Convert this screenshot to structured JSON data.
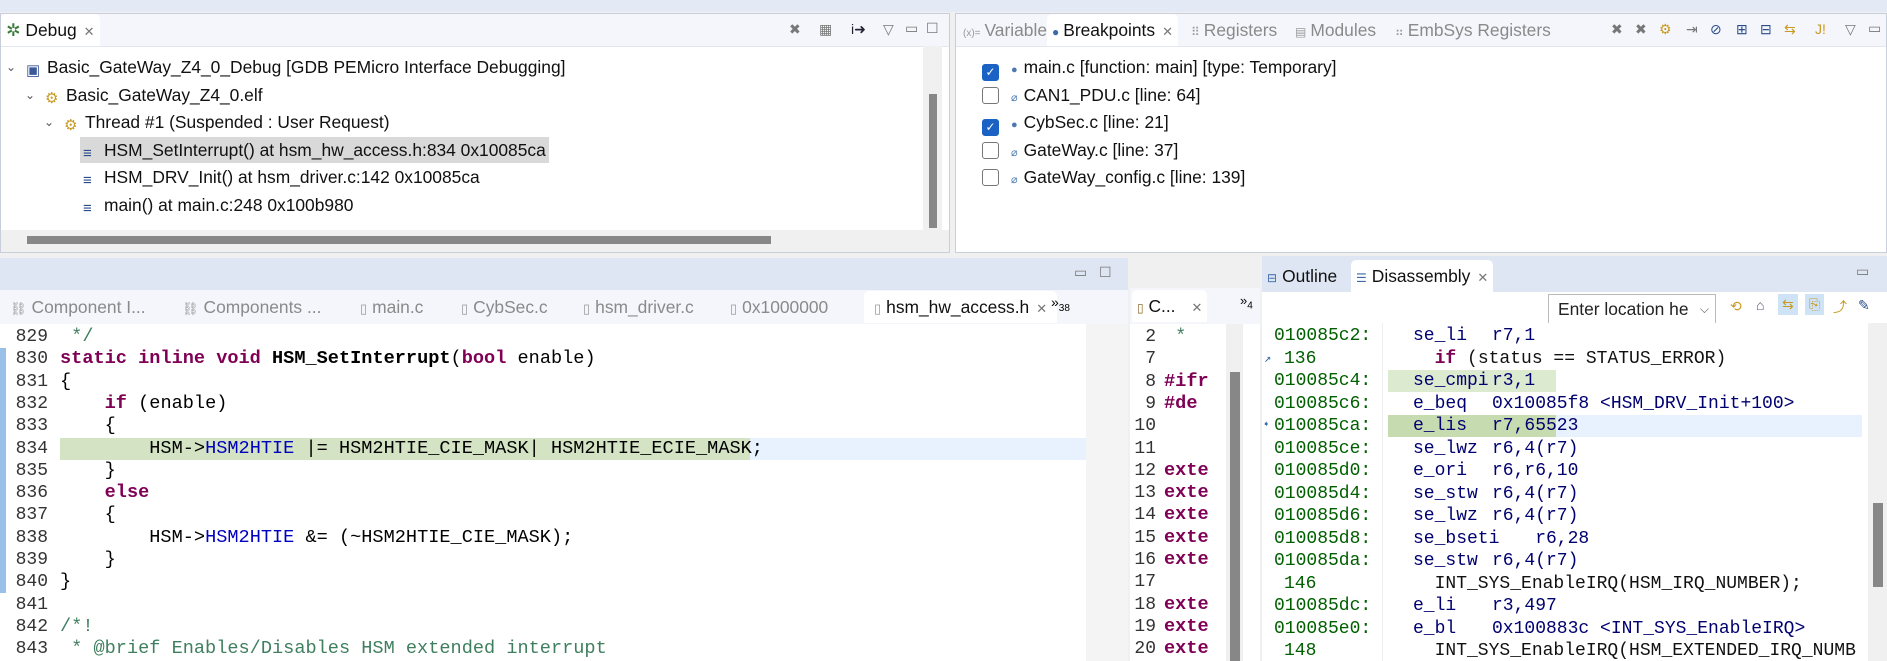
{
  "debug": {
    "tab_label": "Debug",
    "tree": [
      {
        "label": "Basic_GateWay_Z4_0_Debug [GDB PEMicro Interface Debugging]",
        "icon": "launch-config-icon",
        "level": 0
      },
      {
        "label": "Basic_GateWay_Z4_0.elf",
        "icon": "process-icon",
        "level": 1
      },
      {
        "label": "Thread #1 (Suspended : User Request)",
        "icon": "thread-icon",
        "level": 2
      },
      {
        "label": "HSM_SetInterrupt() at hsm_hw_access.h:834 0x10085ca",
        "icon": "stack-frame-icon",
        "level": 3,
        "selected": true
      },
      {
        "label": "HSM_DRV_Init() at hsm_driver.c:142 0x10085ca",
        "icon": "stack-frame-icon",
        "level": 3
      },
      {
        "label": "main() at main.c:248 0x100b980",
        "icon": "stack-frame-icon",
        "level": 3
      }
    ]
  },
  "breakpoints_view": {
    "tabs": [
      {
        "label": "Variables",
        "icon": "variables-icon"
      },
      {
        "label": "Breakpoints",
        "icon": "breakpoints-icon",
        "active": true
      },
      {
        "label": "Registers",
        "icon": "registers-icon"
      },
      {
        "label": "Modules",
        "icon": "modules-icon"
      },
      {
        "label": "EmbSys Registers",
        "icon": "embsys-registers-icon"
      }
    ],
    "items": [
      {
        "label": "main.c [function: main] [type: Temporary]",
        "checked": true
      },
      {
        "label": "CAN1_PDU.c [line: 64]",
        "checked": false
      },
      {
        "label": "CybSec.c [line: 21]",
        "checked": true
      },
      {
        "label": "GateWay.c [line: 37]",
        "checked": false
      },
      {
        "label": "GateWay_config.c [line: 139]",
        "checked": false
      }
    ]
  },
  "editor": {
    "tabs": [
      "Component I...",
      "Components ...",
      "main.c",
      "CybSec.c",
      "hsm_driver.c",
      "0x1000000",
      "hsm_hw_access.h"
    ],
    "overflow_count": "38",
    "lines": [
      {
        "n": "829",
        "seg": [
          [
            " */",
            "cm"
          ]
        ]
      },
      {
        "n": "830",
        "seg": [
          [
            "static inline void ",
            "kw"
          ],
          [
            "HSM_SetInterrupt",
            "fn"
          ],
          [
            "(",
            ""
          ],
          [
            "bool",
            "kw"
          ],
          [
            " enable)",
            ""
          ]
        ]
      },
      {
        "n": "831",
        "seg": [
          [
            "{",
            ""
          ]
        ]
      },
      {
        "n": "832",
        "seg": [
          [
            "    ",
            ""
          ],
          [
            "if",
            "kw"
          ],
          [
            " (enable)",
            ""
          ]
        ]
      },
      {
        "n": "833",
        "seg": [
          [
            "    {",
            ""
          ]
        ]
      },
      {
        "n": "834",
        "seg": [
          [
            "        HSM->",
            ""
          ],
          [
            "HSM2HTIE",
            "fld"
          ],
          [
            " |= HSM2HTIE_CIE_MASK| HSM2HTIE_ECIE_MASK;",
            ""
          ]
        ],
        "current": true
      },
      {
        "n": "835",
        "seg": [
          [
            "    }",
            ""
          ]
        ]
      },
      {
        "n": "836",
        "seg": [
          [
            "    ",
            ""
          ],
          [
            "else",
            "kw"
          ]
        ]
      },
      {
        "n": "837",
        "seg": [
          [
            "    {",
            ""
          ]
        ]
      },
      {
        "n": "838",
        "seg": [
          [
            "        HSM->",
            ""
          ],
          [
            "HSM2HTIE",
            "fld"
          ],
          [
            " &= (~HSM2HTIE_CIE_MASK);",
            ""
          ]
        ]
      },
      {
        "n": "839",
        "seg": [
          [
            "    }",
            ""
          ]
        ]
      },
      {
        "n": "840",
        "seg": [
          [
            "}",
            ""
          ]
        ]
      },
      {
        "n": "841",
        "seg": [
          [
            "",
            ""
          ]
        ]
      },
      {
        "n": "842",
        "seg": [
          [
            "/*!",
            "cm"
          ]
        ]
      },
      {
        "n": "843",
        "seg": [
          [
            " * @brief Enables/Disables HSM extended interrupt",
            "cm"
          ]
        ]
      }
    ]
  },
  "side_editor": {
    "tab_label": "C...",
    "overflow_count": "4",
    "lines": [
      {
        "n": "2",
        "seg": [
          [
            " * ",
            "cm"
          ]
        ]
      },
      {
        "n": "7",
        "seg": [
          [
            "",
            ""
          ]
        ]
      },
      {
        "n": "8",
        "seg": [
          [
            "#ifr",
            "kw"
          ]
        ]
      },
      {
        "n": "9",
        "seg": [
          [
            "#de",
            "kw"
          ]
        ]
      },
      {
        "n": "10",
        "seg": [
          [
            "",
            ""
          ]
        ]
      },
      {
        "n": "11",
        "seg": [
          [
            "",
            ""
          ]
        ]
      },
      {
        "n": "12",
        "seg": [
          [
            "exte",
            "kw"
          ]
        ]
      },
      {
        "n": "13",
        "seg": [
          [
            "exte",
            "kw"
          ]
        ]
      },
      {
        "n": "14",
        "seg": [
          [
            "exte",
            "kw"
          ]
        ]
      },
      {
        "n": "15",
        "seg": [
          [
            "exte",
            "kw"
          ]
        ]
      },
      {
        "n": "16",
        "seg": [
          [
            "exte",
            "kw"
          ]
        ]
      },
      {
        "n": "17",
        "seg": [
          [
            "",
            ""
          ]
        ]
      },
      {
        "n": "18",
        "seg": [
          [
            "exte",
            "kw"
          ]
        ]
      },
      {
        "n": "19",
        "seg": [
          [
            "exte",
            "kw"
          ]
        ]
      },
      {
        "n": "20",
        "seg": [
          [
            "exte",
            "kw"
          ]
        ]
      }
    ]
  },
  "disassembly": {
    "tabs": [
      {
        "label": "Outline"
      },
      {
        "label": "Disassembly",
        "active": true
      }
    ],
    "location_placeholder": "Enter location he",
    "rows": [
      {
        "addr": "010085c2:",
        "mn": "se_li",
        "op": "r7,1"
      },
      {
        "src": "136",
        "code": [
          [
            "  ",
            ""
          ],
          [
            "if",
            "kw"
          ],
          [
            " (status == STATUS_ERROR)",
            ""
          ]
        ]
      },
      {
        "addr": "010085c4:",
        "mn": "se_cmpi",
        "op": "r3,1",
        "hl": "light"
      },
      {
        "addr": "010085c6:",
        "mn": "e_beq",
        "op": "0x10085f8 <HSM_DRV_Init+100>"
      },
      {
        "addr": "010085ca:",
        "mn": "e_lis",
        "op": "r7,65523",
        "hl": "current"
      },
      {
        "addr": "010085ce:",
        "mn": "se_lwz",
        "op": "r6,4(r7)"
      },
      {
        "addr": "010085d0:",
        "mn": "e_ori",
        "op": "r6,r6,10"
      },
      {
        "addr": "010085d4:",
        "mn": "se_stw",
        "op": "r6,4(r7)"
      },
      {
        "addr": "010085d6:",
        "mn": "se_lwz",
        "op": "r6,4(r7)"
      },
      {
        "addr": "010085d8:",
        "mn": "se_bseti",
        "op": "    r6,28"
      },
      {
        "addr": "010085da:",
        "mn": "se_stw",
        "op": "r6,4(r7)"
      },
      {
        "src": "146",
        "code": [
          [
            "  INT_SYS_EnableIRQ(HSM_IRQ_NUMBER);",
            ""
          ]
        ]
      },
      {
        "addr": "010085dc:",
        "mn": "e_li",
        "op": "r3,497"
      },
      {
        "addr": "010085e0:",
        "mn": "e_bl",
        "op": "0x100883c <INT_SYS_EnableIRQ>"
      },
      {
        "src": "148",
        "code": [
          [
            "  INT_SYS_EnableIRQ(HSM_EXTENDED_IRQ_NUMB",
            ""
          ]
        ]
      }
    ]
  }
}
